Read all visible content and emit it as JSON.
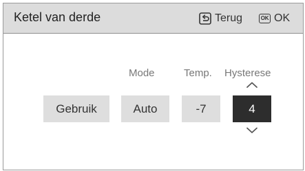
{
  "header": {
    "title": "Ketel van derde",
    "back_label": "Terug",
    "ok_icon_text": "OK",
    "ok_label": "OK"
  },
  "columns": {
    "mode_label": "Mode",
    "temp_label": "Temp.",
    "hysteresis_label": "Hysterese"
  },
  "fields": {
    "usage": "Gebruik",
    "mode": "Auto",
    "temp": "-7",
    "hysteresis": "4"
  },
  "icons": {
    "back": "back-arrow-icon",
    "ok": "ok-key-icon",
    "up": "chevron-up-icon",
    "down": "chevron-down-icon"
  },
  "colors": {
    "header_bg": "#dcdcdc",
    "field_bg": "#dedede",
    "active_field_bg": "#2d2d2d",
    "label_text": "#777777"
  }
}
